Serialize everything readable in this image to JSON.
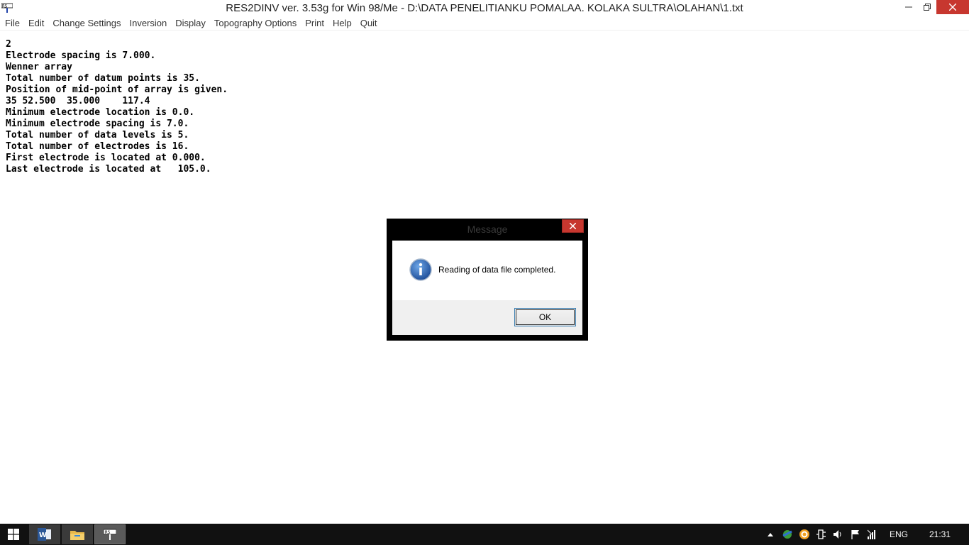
{
  "window": {
    "title": "RES2DINV ver. 3.53g for Win 98/Me - D:\\DATA PENELITIANKU POMALAA. KOLAKA SULTRA\\OLAHAN\\1.txt",
    "app_icon": "res2dinv-icon"
  },
  "menu": {
    "items": [
      {
        "label": "File"
      },
      {
        "label": "Edit"
      },
      {
        "label": "Change Settings"
      },
      {
        "label": "Inversion"
      },
      {
        "label": "Display"
      },
      {
        "label": "Topography Options"
      },
      {
        "label": "Print"
      },
      {
        "label": "Help"
      },
      {
        "label": "Quit"
      }
    ]
  },
  "content": {
    "lines": [
      "2",
      "Electrode spacing is 7.000.",
      "Wenner array",
      "Total number of datum points is 35.",
      "Position of mid-point of array is given.",
      "35 52.500  35.000    117.4",
      "Minimum electrode location is 0.0.",
      "Minimum electrode spacing is 7.0.",
      "Total number of data levels is 5.",
      "Total number of electrodes is 16.",
      "First electrode is located at 0.000.",
      "Last electrode is located at   105.0."
    ]
  },
  "dialog": {
    "title": "Message",
    "message": "Reading of data file completed.",
    "ok_label": "OK",
    "icon": "info-icon"
  },
  "taskbar": {
    "apps": [
      {
        "name": "word-icon"
      },
      {
        "name": "file-explorer-icon"
      },
      {
        "name": "res2dinv-icon",
        "active": true
      }
    ],
    "language": "ENG",
    "clock": "21:31"
  },
  "colors": {
    "close_red": "#c7372f",
    "taskbar_bg": "#111111",
    "info_blue": "#1f5fb0"
  }
}
